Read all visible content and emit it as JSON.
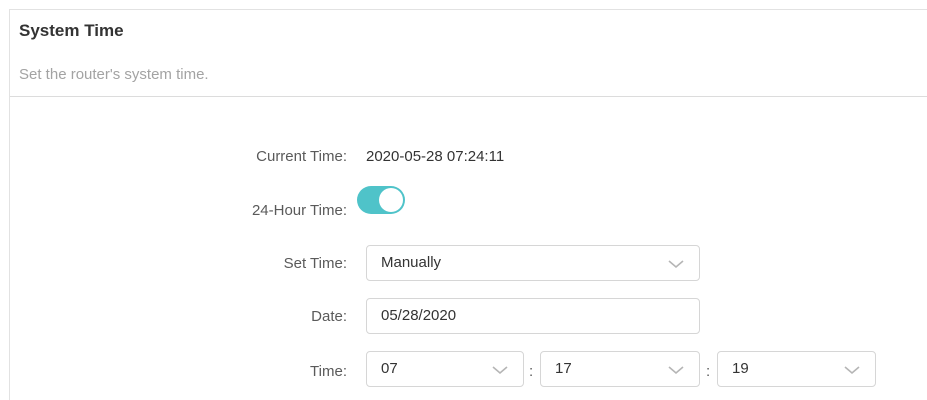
{
  "header": {
    "title": "System Time",
    "description": "Set the router's system time."
  },
  "form": {
    "current_time": {
      "label": "Current Time:",
      "value": "2020-05-28 07:24:11"
    },
    "hour_format": {
      "label": "24-Hour Time:",
      "enabled": true,
      "accent_color": "#4fc3c9"
    },
    "set_time": {
      "label": "Set Time:",
      "selected": "Manually"
    },
    "date": {
      "label": "Date:",
      "value": "05/28/2020"
    },
    "time": {
      "label": "Time:",
      "hour": "07",
      "minute": "17",
      "second": "19",
      "separator": ":"
    }
  },
  "icons": {
    "dropdown": "chevron-down-icon"
  }
}
